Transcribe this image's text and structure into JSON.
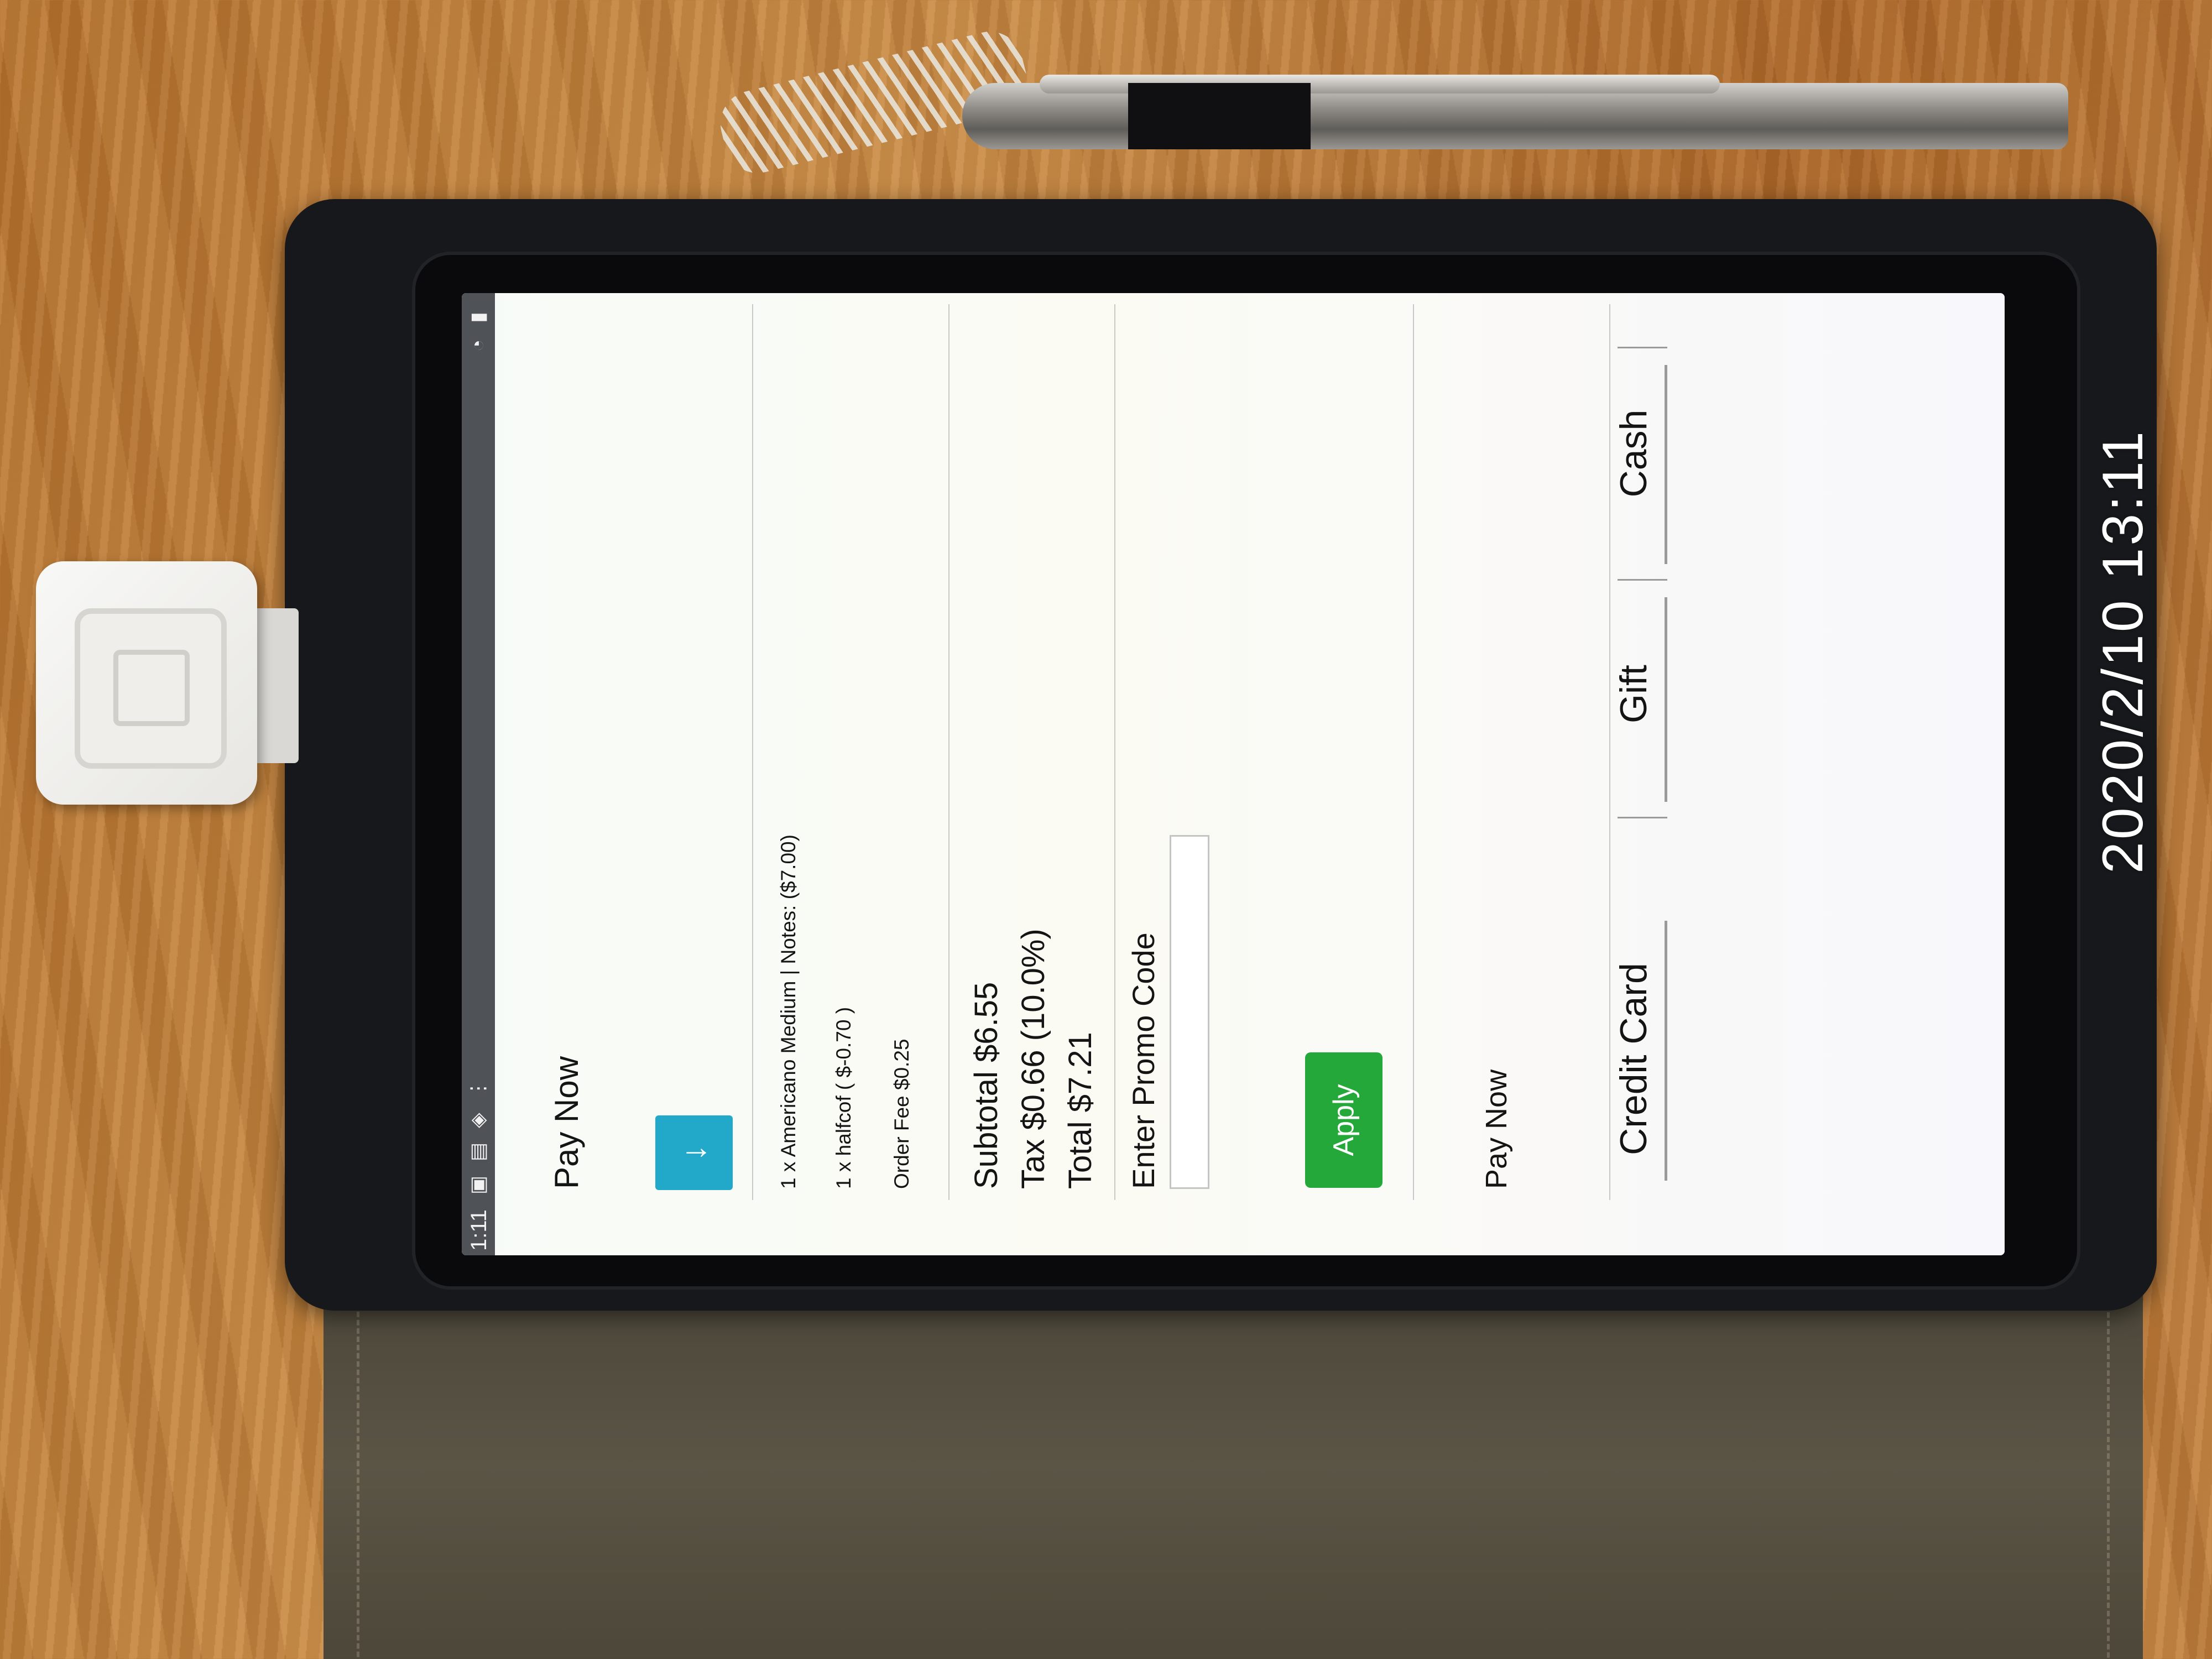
{
  "status_bar": {
    "time": "1:11",
    "icons": "▣ ▤ ◈ ⋮",
    "right_icons": "◔ ▮"
  },
  "header": {
    "title": "Pay Now",
    "collapse_icon": "↓"
  },
  "order": {
    "items": [
      "1 x Americano Medium | Notes: ($7.00)",
      "1 x halfcof ( $-0.70 )",
      "Order Fee $0.25"
    ]
  },
  "totals": {
    "subtotal": "Subtotal $6.55",
    "tax": "Tax $0.66 (10.0%)",
    "total": "Total $7.21"
  },
  "promo": {
    "label": "Enter Promo Code",
    "value": "",
    "apply_label": "Apply"
  },
  "payment": {
    "section_label": "Pay Now",
    "tabs": [
      "Credit Card",
      "Gift",
      "Cash"
    ]
  },
  "photo": {
    "timestamp": "2020/2/10  13:11"
  },
  "colors": {
    "accent_blue": "#22a9c9",
    "apply_green": "#25a83a",
    "statusbar": "#4f5256"
  }
}
